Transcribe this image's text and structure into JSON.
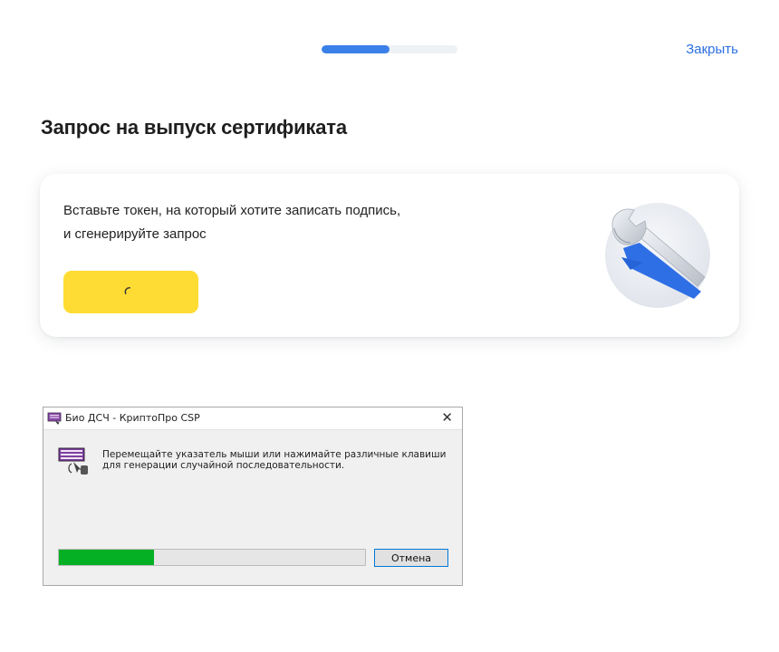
{
  "header": {
    "progress_fraction": 0.5,
    "close_label": "Закрыть"
  },
  "page": {
    "title": "Запрос на выпуск сертификата"
  },
  "card": {
    "text_line1": "Вставьте токен, на который хотите записать подпись,",
    "text_line2": "и сгенерируйте запрос",
    "button_state": "loading",
    "illustration_icon": "wrench-icon"
  },
  "dialog": {
    "title": "Био ДСЧ - КриптоПро CSP",
    "close_glyph": "✕",
    "message_line1": "Перемещайте указатель мыши или нажимайте различные клавиши",
    "message_line2": "для генерации случайной последовательности.",
    "progress_fraction": 0.31,
    "cancel_label": "Отмена"
  },
  "colors": {
    "accent_blue": "#3b7fe8",
    "link_blue": "#2b6fe0",
    "button_yellow": "#fedc33",
    "progress_green": "#06b025"
  }
}
